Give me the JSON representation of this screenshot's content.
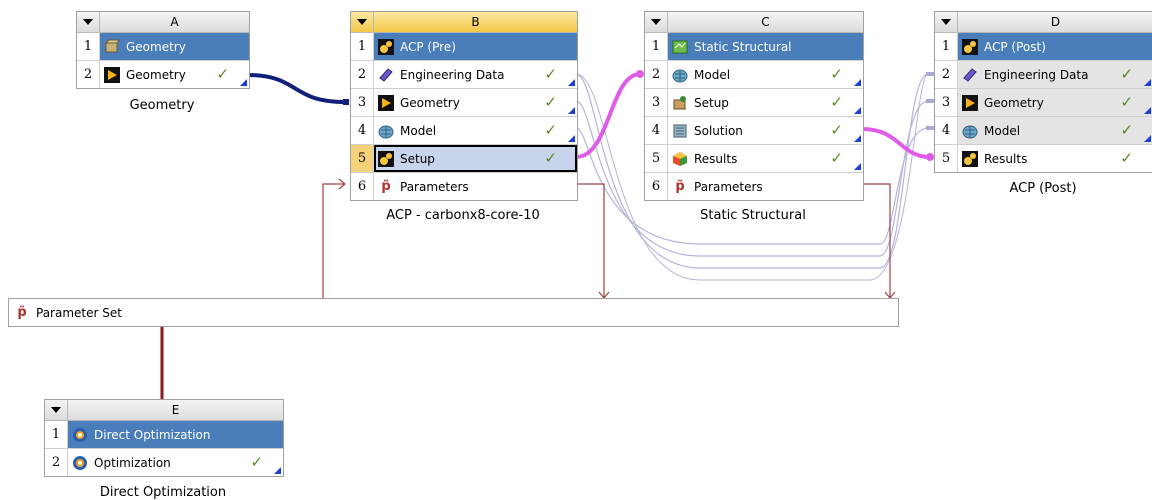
{
  "systems": {
    "A": {
      "letter": "A",
      "caption": "Geometry",
      "rows": [
        {
          "num": "1",
          "label": "Geometry",
          "icon": "geometry-box-icon"
        },
        {
          "num": "2",
          "label": "Geometry",
          "icon": "geometry-play-icon",
          "status": "up-to-date"
        }
      ]
    },
    "B": {
      "letter": "B",
      "caption": "ACP - carbonx8-core-10",
      "rows": [
        {
          "num": "1",
          "label": "ACP (Pre)",
          "icon": "acp-gears-icon"
        },
        {
          "num": "2",
          "label": "Engineering Data",
          "icon": "engineering-data-icon",
          "status": "up-to-date"
        },
        {
          "num": "3",
          "label": "Geometry",
          "icon": "geometry-play-icon",
          "status": "up-to-date"
        },
        {
          "num": "4",
          "label": "Model",
          "icon": "model-icon",
          "status": "up-to-date"
        },
        {
          "num": "5",
          "label": "Setup",
          "icon": "setup-gears-icon",
          "status": "up-to-date"
        },
        {
          "num": "6",
          "label": "Parameters",
          "icon": "parameters-icon"
        }
      ]
    },
    "C": {
      "letter": "C",
      "caption": "Static Structural",
      "rows": [
        {
          "num": "1",
          "label": "Static Structural",
          "icon": "static-structural-icon"
        },
        {
          "num": "2",
          "label": "Model",
          "icon": "model-icon",
          "status": "up-to-date"
        },
        {
          "num": "3",
          "label": "Setup",
          "icon": "setup-icon",
          "status": "up-to-date"
        },
        {
          "num": "4",
          "label": "Solution",
          "icon": "solution-icon",
          "status": "up-to-date"
        },
        {
          "num": "5",
          "label": "Results",
          "icon": "results-icon",
          "status": "up-to-date"
        },
        {
          "num": "6",
          "label": "Parameters",
          "icon": "parameters-icon"
        }
      ]
    },
    "D": {
      "letter": "D",
      "caption": "ACP (Post)",
      "rows": [
        {
          "num": "1",
          "label": "ACP (Post)",
          "icon": "acp-gears-icon"
        },
        {
          "num": "2",
          "label": "Engineering Data",
          "icon": "engineering-data-icon",
          "status": "up-to-date"
        },
        {
          "num": "3",
          "label": "Geometry",
          "icon": "geometry-play-icon",
          "status": "up-to-date"
        },
        {
          "num": "4",
          "label": "Model",
          "icon": "model-icon",
          "status": "up-to-date"
        },
        {
          "num": "5",
          "label": "Results",
          "icon": "acp-gears-icon",
          "status": "up-to-date"
        }
      ]
    },
    "E": {
      "letter": "E",
      "caption": "Direct Optimization",
      "rows": [
        {
          "num": "1",
          "label": "Direct Optimization",
          "icon": "optimization-icon"
        },
        {
          "num": "2",
          "label": "Optimization",
          "icon": "optimization-icon",
          "status": "up-to-date"
        }
      ]
    }
  },
  "parameter_set": {
    "label": "Parameter Set",
    "icon": "parameters-icon"
  },
  "colors": {
    "title_row": "#4a7ebb",
    "selected_row": "#c8d4ec",
    "active_header": "#f3c84a",
    "geometry_link": "#0f1f7a",
    "transfer_link": "#e05be8",
    "share_link": "#b4b4dc",
    "parameter_link": "#a04040",
    "check": "#5a8a2a"
  }
}
